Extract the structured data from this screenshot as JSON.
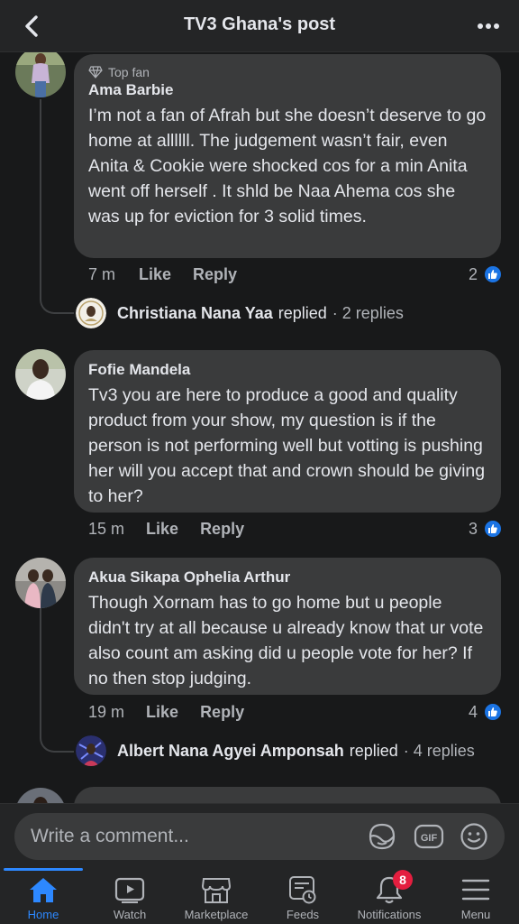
{
  "header": {
    "title": "TV3 Ghana's post"
  },
  "comments": [
    {
      "badge": "Top fan",
      "name": "Ama Barbie",
      "text": "I’m not a fan of Afrah but she doesn’t deserve to go home at allllll. The judgement wasn’t fair, even Anita & Cookie were shocked cos for a min Anita went off herself . It shld be Naa Ahema cos she was up for eviction for 3 solid times.",
      "time": "7 m",
      "like_label": "Like",
      "reply_label": "Reply",
      "reactions": "2",
      "reply_preview": {
        "name": "Christiana Nana Yaa",
        "text": "replied",
        "count": "· 2 replies"
      }
    },
    {
      "name": "Fofie Mandela",
      "text": "Tv3 you are here to produce a good and quality product from your show, my question is if the person is not performing well but votting is pushing her will you accept that and crown should be giving to her?",
      "time": "15 m",
      "like_label": "Like",
      "reply_label": "Reply",
      "reactions": "3"
    },
    {
      "name": "Akua Sikapa Ophelia Arthur",
      "text": "Though Xornam has to go home  but u people didn't try at all because u already know that ur vote also count  am asking did u people vote for her?  If no then stop judging.",
      "time": "19 m",
      "like_label": "Like",
      "reply_label": "Reply",
      "reactions": "4",
      "reply_preview": {
        "name": "Albert Nana Agyei Amponsah",
        "text": "replied",
        "count": "· 4 replies"
      }
    }
  ],
  "composer": {
    "placeholder": "Write a comment..."
  },
  "tabs": [
    {
      "label": "Home",
      "icon": "home-icon",
      "active": true
    },
    {
      "label": "Watch",
      "icon": "watch-icon"
    },
    {
      "label": "Marketplace",
      "icon": "marketplace-icon"
    },
    {
      "label": "Feeds",
      "icon": "feeds-icon"
    },
    {
      "label": "Notifications",
      "icon": "bell-icon",
      "badge": "8"
    },
    {
      "label": "Menu",
      "icon": "menu-icon"
    }
  ],
  "colors": {
    "accent": "#2d88ff",
    "like": "#1b74e4",
    "badge": "#e41e3f",
    "bubble": "#3a3b3c",
    "background": "#18191a"
  }
}
